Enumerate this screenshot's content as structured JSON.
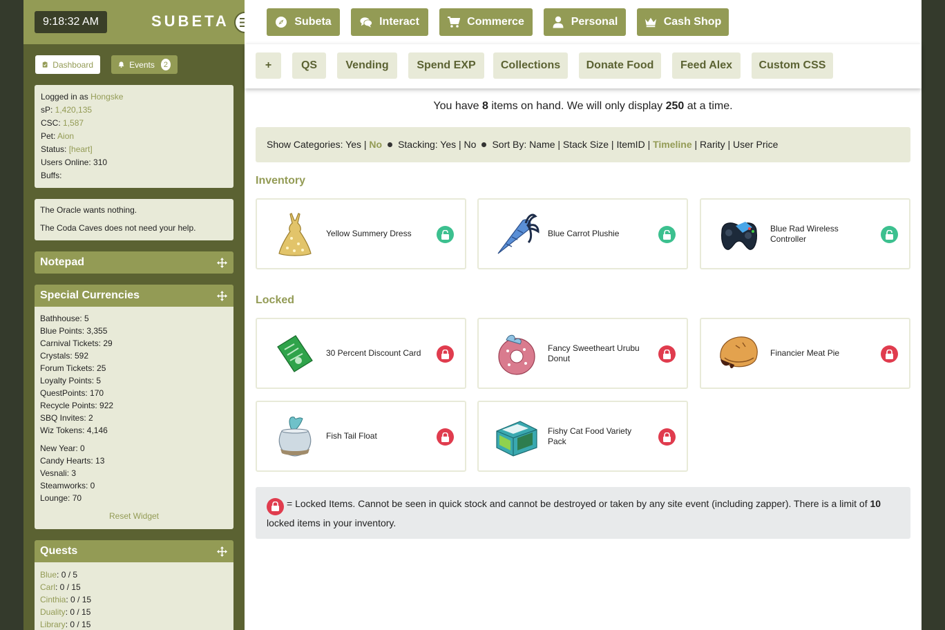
{
  "sidebar": {
    "clock": "9:18:32 AM",
    "brand": "SUBETA",
    "dashboard_label": "Dashboard",
    "events_label": "Events",
    "events_count": "2",
    "user": {
      "logged_prefix": "Logged in as ",
      "username": "Hongske",
      "sp_label": "sP: ",
      "sp_value": "1,420,135",
      "csc_label": "CSC: ",
      "csc_value": "1,587",
      "pet_label": "Pet: ",
      "pet_value": "Aion",
      "status_label": "Status: ",
      "status_value": "[heart]",
      "users_online": "Users Online: 310",
      "buffs": "Buffs:"
    },
    "oracle": [
      "The Oracle wants nothing.",
      "The Coda Caves does not need your help."
    ],
    "notepad_title": "Notepad",
    "special_title": "Special Currencies",
    "special_group1": [
      "Bathhouse: 5",
      "Blue Points: 3,355",
      "Carnival Tickets: 29",
      "Crystals: 592",
      "Forum Tickets: 25",
      "Loyalty Points: 5",
      "QuestPoints: 170",
      "Recycle Points: 922",
      "SBQ Invites: 2",
      "Wiz Tokens: 4,146"
    ],
    "special_group2": [
      "New Year: 0",
      "Candy Hearts: 13",
      "Vesnali: 3",
      "Steamworks: 0",
      "Lounge: 70"
    ],
    "reset_label": "Reset Widget",
    "quests_title": "Quests",
    "quests": [
      {
        "name": "Blue",
        "value": ": 0 / 5"
      },
      {
        "name": "Carl",
        "value": ": 0 / 15"
      },
      {
        "name": "Cinthia",
        "value": ": 0 / 15"
      },
      {
        "name": "Duality",
        "value": ": 0 / 15"
      },
      {
        "name": "Library",
        "value": ": 0 / 15"
      }
    ]
  },
  "topnav": [
    "Subeta",
    "Interact",
    "Commerce",
    "Personal",
    "Cash Shop"
  ],
  "subnav": [
    "+",
    "QS",
    "Vending",
    "Spend EXP",
    "Collections",
    "Donate Food",
    "Feed Alex",
    "Custom CSS"
  ],
  "onhand": {
    "pre": "You have ",
    "count": "8",
    "mid": " items on hand. We will only display ",
    "limit": "250",
    "post": " at a time."
  },
  "options": {
    "show_label": "Show Categories: Yes | ",
    "show_no": "No",
    "stacking": "Stacking: Yes | No",
    "sort_pre": "Sort By: Name | Stack Size | ItemID | ",
    "sort_sel": "Timeline",
    "sort_post": " | Rarity | User Price"
  },
  "inventory_title": "Inventory",
  "locked_title": "Locked",
  "inventory": [
    {
      "name": "Yellow Summery Dress",
      "icon": "dress-icon"
    },
    {
      "name": "Blue Carrot Plushie",
      "icon": "carrot-plushie-icon"
    },
    {
      "name": "Blue Rad Wireless Controller",
      "icon": "controller-icon"
    }
  ],
  "locked": [
    {
      "name": "30 Percent Discount Card",
      "icon": "discount-card-icon"
    },
    {
      "name": "Fancy Sweetheart Urubu Donut",
      "icon": "donut-icon"
    },
    {
      "name": "Financier Meat Pie",
      "icon": "meat-pie-icon"
    },
    {
      "name": "Fish Tail Float",
      "icon": "fish-bowl-icon"
    },
    {
      "name": "Fishy Cat Food Variety Pack",
      "icon": "cat-food-icon"
    }
  ],
  "legend": {
    "pre": "= Locked Items. Cannot be seen in quick stock and cannot be destroyed or taken by any site event (including zapper). There is a limit of ",
    "limit": "10",
    "post": " locked items in your inventory."
  },
  "colors": {
    "olive": "#939b55",
    "dark_olive": "#5b6232",
    "pale": "#e8ead8",
    "unlock": "#3cc08f",
    "lock": "#e03c4e"
  }
}
